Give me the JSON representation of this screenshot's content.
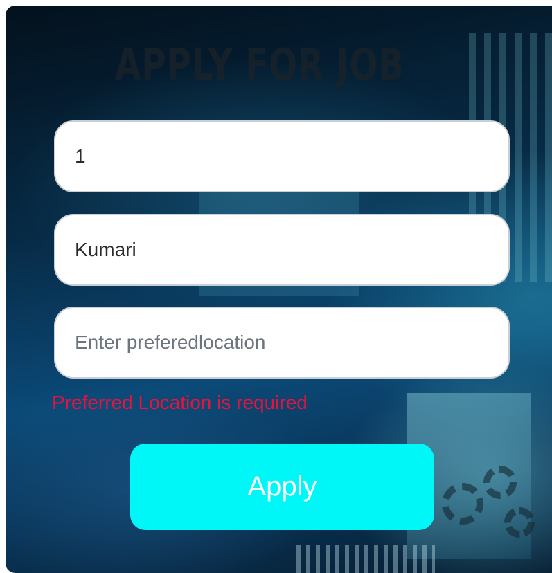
{
  "form": {
    "title": "APPLY FOR JOB",
    "fields": [
      {
        "value": "1",
        "placeholder": ""
      },
      {
        "value": "Kumari",
        "placeholder": ""
      },
      {
        "value": "",
        "placeholder": "Enter preferedlocation"
      }
    ],
    "error_message": "Preferred Location is required",
    "submit_label": "Apply"
  },
  "colors": {
    "button_background": "#00f7f7",
    "error_text": "#e8123e",
    "title_text": "#1b2329"
  }
}
